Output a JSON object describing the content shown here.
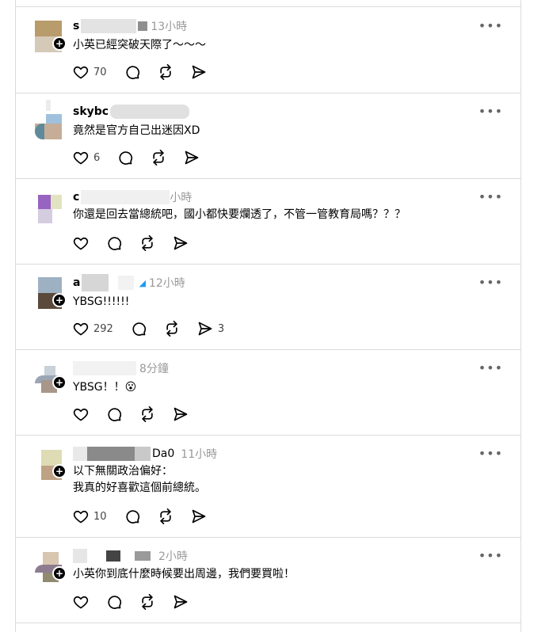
{
  "posts": [
    {
      "user": "s",
      "time": "13小時",
      "text": [
        "小英已經突破天際了～～～"
      ],
      "likes": "70",
      "shares": ""
    },
    {
      "user": "skybc",
      "time": "",
      "text": [
        "竟然是官方自己出迷因XD"
      ],
      "likes": "6",
      "shares": ""
    },
    {
      "user": "c",
      "time": "小時",
      "text": [
        "你還是回去當總統吧，國小都快要爛透了，不管一管教育局嗎？？？"
      ],
      "likes": "",
      "shares": ""
    },
    {
      "user": "a",
      "time": "12小時",
      "text": [
        "YBSG!!!!!!"
      ],
      "likes": "292",
      "shares": "3"
    },
    {
      "user": "",
      "time": "8分鐘",
      "text": [
        "YBSG！！😮"
      ],
      "likes": "",
      "shares": ""
    },
    {
      "user": "",
      "time": "11小時",
      "handle_tail": "Da0",
      "text": [
        "以下無關政治偏好：",
        "我真的好喜歡這個前總統。"
      ],
      "likes": "10",
      "shares": ""
    },
    {
      "user": "",
      "time": "2小時",
      "text": [
        "小英你到底什麼時候要出周邊，我們要買啦！"
      ],
      "likes": "",
      "shares": ""
    }
  ],
  "more_glyph": "•••",
  "plus_glyph": "+",
  "icons": [
    "heart-icon",
    "comment-icon",
    "repost-icon",
    "send-icon"
  ]
}
